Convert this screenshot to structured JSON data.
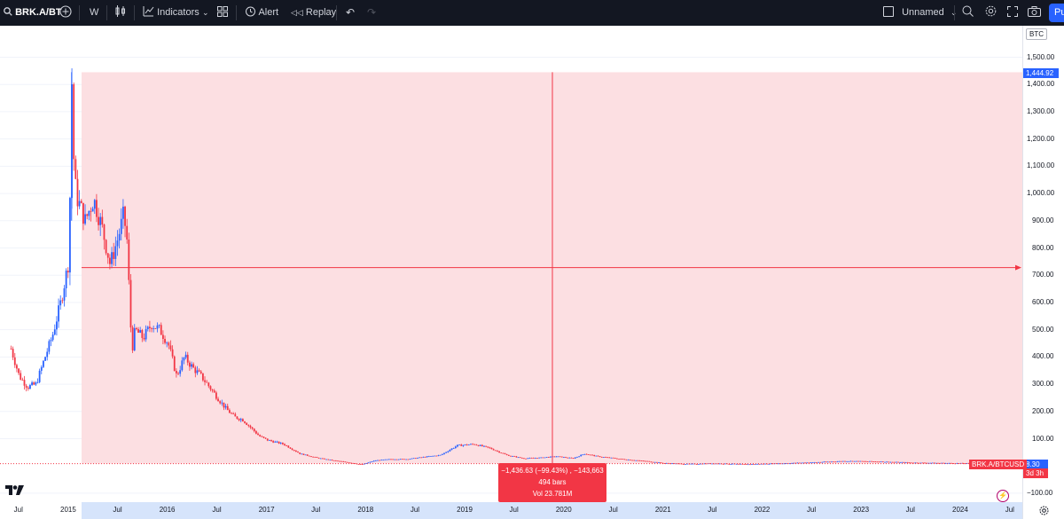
{
  "toolbar": {
    "symbol": "BRK.A/BT",
    "interval": "W",
    "indicators_label": "Indicators",
    "alert_label": "Alert",
    "replay_label": "Replay",
    "layout_name": "Unnamed",
    "publish_label": "Pu"
  },
  "price_axis": {
    "currency": "BTC",
    "labels": [
      "1,500.00",
      "1,400.00",
      "1,300.00",
      "1,200.00",
      "1,100.00",
      "1,000.00",
      "900.00",
      "800.00",
      "700.00",
      "600.00",
      "500.00",
      "400.00",
      "300.00",
      "200.00",
      "100.00",
      "−100.00"
    ],
    "high_badge": "1,444.92",
    "last_price_badge": "8.30",
    "countdown_badge": "3d 3h",
    "series_badge": "BRK.A/BTCUSD"
  },
  "time_axis": {
    "labels": [
      "Jul",
      "2015",
      "Jul",
      "2016",
      "Jul",
      "2017",
      "Jul",
      "2018",
      "Jul",
      "2019",
      "Jul",
      "2020",
      "Jul",
      "2021",
      "Jul",
      "2022",
      "Jul",
      "2023",
      "Jul",
      "2024",
      "Jul"
    ]
  },
  "measure": {
    "line1": "−1,436.63 (−99.43%) , −143,663",
    "line2": "494 bars",
    "line3": "Vol 23.781M"
  },
  "colors": {
    "up": "#2962ff",
    "down": "#f23645",
    "measure_fill": "#fcdde0",
    "toolbar_bg": "#131722",
    "accent": "#2962ff"
  },
  "chart_data": {
    "type": "candlestick",
    "symbol": "BRK.A/BTCUSD",
    "interval": "W",
    "y_unit": "BTC",
    "ylim": [
      -110,
      1560
    ],
    "x_range": [
      "2014-06",
      "2024-08"
    ],
    "last_price": 8.3,
    "high_marker": 1444.92,
    "crosshair_price_approx": 728,
    "measure_range": {
      "from_price": 1444.92,
      "to_price": 8.3,
      "change": -1436.63,
      "change_pct": -99.43,
      "bars": 494
    },
    "price_path": [
      [
        "2014-06-01",
        430
      ],
      [
        "2014-07-01",
        330
      ],
      [
        "2014-08-01",
        290
      ],
      [
        "2014-09-01",
        300
      ],
      [
        "2014-10-01",
        390
      ],
      [
        "2014-11-01",
        480
      ],
      [
        "2014-12-01",
        600
      ],
      [
        "2015-01-01",
        760
      ],
      [
        "2015-01-10",
        1444.92
      ],
      [
        "2015-01-20",
        1050
      ],
      [
        "2015-02-01",
        980
      ],
      [
        "2015-03-01",
        900
      ],
      [
        "2015-04-01",
        980
      ],
      [
        "2015-05-01",
        880
      ],
      [
        "2015-06-01",
        740
      ],
      [
        "2015-07-01",
        840
      ],
      [
        "2015-07-20",
        920
      ],
      [
        "2015-08-01",
        850
      ],
      [
        "2015-08-20",
        420
      ],
      [
        "2015-09-01",
        500
      ],
      [
        "2015-10-01",
        470
      ],
      [
        "2015-11-01",
        520
      ],
      [
        "2015-12-01",
        500
      ],
      [
        "2016-01-01",
        450
      ],
      [
        "2016-02-01",
        330
      ],
      [
        "2016-03-01",
        400
      ],
      [
        "2016-04-01",
        360
      ],
      [
        "2016-05-01",
        330
      ],
      [
        "2016-06-01",
        290
      ],
      [
        "2016-07-01",
        250
      ],
      [
        "2016-08-01",
        210
      ],
      [
        "2016-09-01",
        180
      ],
      [
        "2016-10-01",
        170
      ],
      [
        "2016-11-01",
        140
      ],
      [
        "2016-12-01",
        110
      ],
      [
        "2017-01-01",
        95
      ],
      [
        "2017-03-01",
        80
      ],
      [
        "2017-05-01",
        45
      ],
      [
        "2017-07-01",
        30
      ],
      [
        "2017-09-01",
        20
      ],
      [
        "2017-11-01",
        12
      ],
      [
        "2017-12-15",
        5
      ],
      [
        "2018-02-01",
        20
      ],
      [
        "2018-04-01",
        25
      ],
      [
        "2018-06-01",
        25
      ],
      [
        "2018-08-01",
        33
      ],
      [
        "2018-10-01",
        40
      ],
      [
        "2018-12-01",
        75
      ],
      [
        "2019-02-01",
        80
      ],
      [
        "2019-04-01",
        65
      ],
      [
        "2019-06-01",
        40
      ],
      [
        "2019-08-01",
        28
      ],
      [
        "2019-10-01",
        30
      ],
      [
        "2019-12-01",
        35
      ],
      [
        "2020-02-01",
        28
      ],
      [
        "2020-03-15",
        45
      ],
      [
        "2020-05-01",
        35
      ],
      [
        "2020-08-01",
        25
      ],
      [
        "2020-11-01",
        17
      ],
      [
        "2021-01-01",
        10
      ],
      [
        "2021-04-01",
        7
      ],
      [
        "2021-07-01",
        9
      ],
      [
        "2021-11-01",
        6
      ],
      [
        "2022-03-01",
        9
      ],
      [
        "2022-07-01",
        13
      ],
      [
        "2022-11-01",
        18
      ],
      [
        "2023-03-01",
        16
      ],
      [
        "2023-07-01",
        12
      ],
      [
        "2023-12-01",
        10
      ],
      [
        "2024-03-01",
        9
      ],
      [
        "2024-05-01",
        8.3
      ]
    ]
  }
}
